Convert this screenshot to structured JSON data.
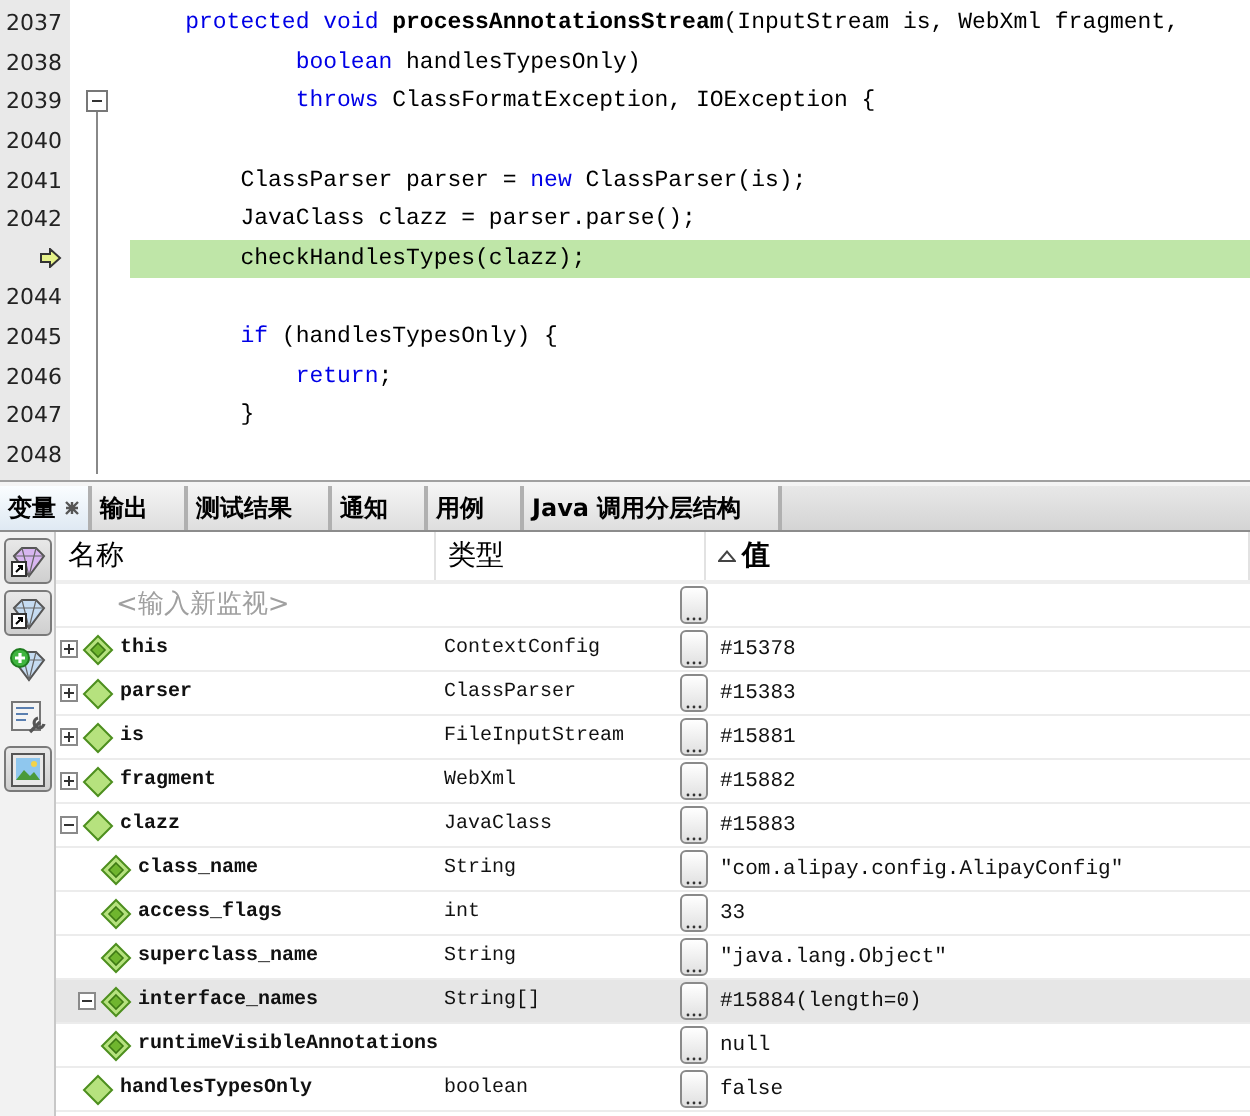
{
  "editor": {
    "lines": [
      {
        "number": "2037",
        "current": false,
        "fold": false,
        "segments": [
          {
            "kind": "keyword",
            "text": "    protected void "
          },
          {
            "kind": "bold",
            "text": "processAnnotationsStream"
          },
          {
            "kind": "plain",
            "text": "(InputStream is, WebXml fragment,"
          }
        ]
      },
      {
        "number": "2038",
        "current": false,
        "fold": false,
        "segments": [
          {
            "kind": "keyword",
            "text": "            boolean"
          },
          {
            "kind": "plain",
            "text": " handlesTypesOnly)"
          }
        ]
      },
      {
        "number": "2039",
        "current": false,
        "fold": true,
        "segments": [
          {
            "kind": "keyword",
            "text": "            throws"
          },
          {
            "kind": "plain",
            "text": " ClassFormatException, IOException {"
          }
        ]
      },
      {
        "number": "2040",
        "current": false,
        "fold": false
      },
      {
        "number": "2041",
        "current": false,
        "fold": false,
        "segments": [
          {
            "kind": "plain",
            "text": "        ClassParser parser = "
          },
          {
            "kind": "keyword",
            "text": "new"
          },
          {
            "kind": "plain",
            "text": " ClassParser(is);"
          }
        ]
      },
      {
        "number": "2042",
        "current": false,
        "fold": false,
        "segments": [
          {
            "kind": "plain",
            "text": "        JavaClass clazz = parser.parse();"
          }
        ]
      },
      {
        "current": true,
        "fold": false,
        "segments": [
          {
            "kind": "plain",
            "text": "        checkHandlesTypes(clazz);"
          }
        ]
      },
      {
        "number": "2044",
        "current": false,
        "fold": false
      },
      {
        "number": "2045",
        "current": false,
        "fold": false,
        "segments": [
          {
            "kind": "keyword",
            "text": "        if"
          },
          {
            "kind": "plain",
            "text": " (handlesTypesOnly) {"
          }
        ]
      },
      {
        "number": "2046",
        "current": false,
        "fold": false,
        "segments": [
          {
            "kind": "keyword",
            "text": "            return"
          },
          {
            "kind": "plain",
            "text": ";"
          }
        ]
      },
      {
        "number": "2047",
        "current": false,
        "fold": false,
        "segments": [
          {
            "kind": "plain",
            "text": "        }"
          }
        ]
      },
      {
        "number": "2048",
        "current": false,
        "fold": false
      }
    ]
  },
  "tabs": [
    {
      "label": "变量",
      "selected": true,
      "closable": true
    },
    {
      "label": "输出",
      "selected": false,
      "closable": false
    },
    {
      "label": "测试结果",
      "selected": false,
      "closable": false
    },
    {
      "label": "通知",
      "selected": false,
      "closable": false
    },
    {
      "label": "用例",
      "selected": false,
      "closable": false
    },
    {
      "label": "Java 调用分层结构",
      "selected": false,
      "closable": false
    }
  ],
  "toolbar": [
    {
      "kind": "pinned-watch",
      "pressed": true
    },
    {
      "kind": "watch-link",
      "pressed": true
    },
    {
      "kind": "new-watch",
      "pressed": false
    },
    {
      "kind": "settings-sheet",
      "pressed": false
    },
    {
      "kind": "picture",
      "pressed": true
    }
  ],
  "table": {
    "columns": [
      {
        "label": "名称",
        "sorted": false
      },
      {
        "label": "类型",
        "sorted": false
      },
      {
        "label": "值",
        "sorted": true
      }
    ],
    "new_watch": {
      "placeholder": "<输入新监视>"
    },
    "rows": [
      {
        "kind": "field",
        "name": "this",
        "type": "ContextConfig",
        "value": "#15378",
        "expanded": false,
        "selected": false
      },
      {
        "kind": "local",
        "name": "parser",
        "type": "ClassParser",
        "value": "#15383",
        "expanded": false,
        "selected": false
      },
      {
        "kind": "local",
        "name": "is",
        "type": "FileInputStream",
        "value": "#15881",
        "expanded": false,
        "selected": false
      },
      {
        "kind": "local",
        "name": "fragment",
        "type": "WebXml",
        "value": "#15882",
        "expanded": false,
        "selected": false
      },
      {
        "kind": "local",
        "name": "clazz",
        "type": "JavaClass",
        "value": "#15883",
        "expanded": true,
        "selected": false,
        "children": [
          {
            "kind": "field",
            "name": "class_name",
            "type": "String",
            "value": "\"com.alipay.config.AlipayConfig\"",
            "selected": false
          },
          {
            "kind": "field",
            "name": "access_flags",
            "type": "int",
            "value": "33",
            "selected": false
          },
          {
            "kind": "field",
            "name": "superclass_name",
            "type": "String",
            "value": "\"java.lang.Object\"",
            "selected": false
          },
          {
            "kind": "field",
            "name": "interface_names",
            "type": "String[]",
            "value": "#15884(length=0)",
            "expanded": true,
            "selected": true
          },
          {
            "kind": "field",
            "name": "runtimeVisibleAnnotations",
            "value": "null",
            "selected": false
          }
        ]
      },
      {
        "kind": "local",
        "name": "handlesTypesOnly",
        "type": "boolean",
        "value": "false",
        "selected": false
      }
    ]
  }
}
